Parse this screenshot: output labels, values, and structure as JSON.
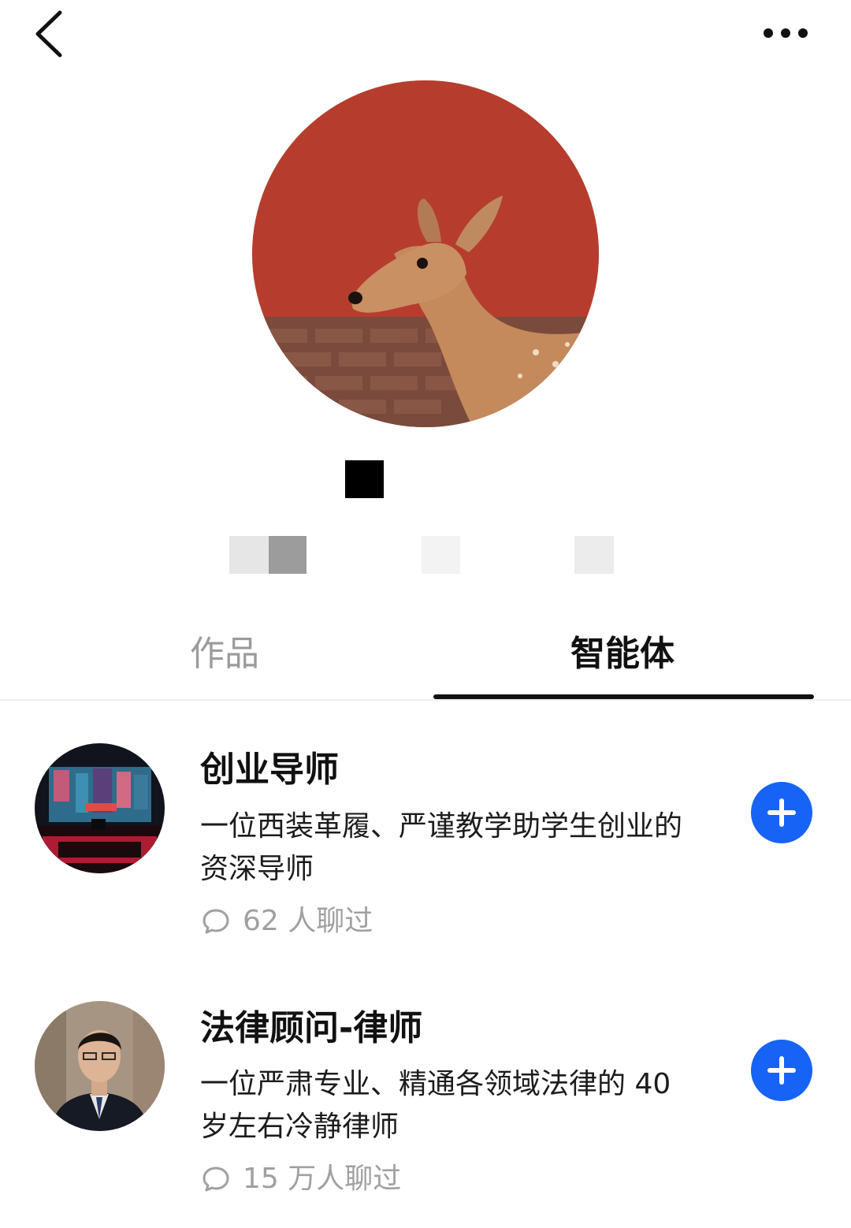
{
  "header": {
    "back_icon": "chevron-left-icon",
    "more_icon": "more-dots-icon"
  },
  "profile": {
    "avatar_desc": "deer-avatar",
    "accent_wall": "#b23a2a"
  },
  "tabs": [
    {
      "label": "作品",
      "active": false
    },
    {
      "label": "智能体",
      "active": true
    }
  ],
  "agents": [
    {
      "name": "创业导师",
      "desc_line1": "一位西装革履、严谨教学助学生创业的",
      "desc_line2": "资深导师",
      "chats": "62 人聊过"
    },
    {
      "name": "法律顾问-律师",
      "desc_line1": "一位严肃专业、精通各领域法律的 40",
      "desc_line2": "岁左右冷静律师",
      "chats": "15 万人聊过"
    }
  ],
  "colors": {
    "accent": "#1763f5",
    "text": "#111111",
    "muted": "#a0a0a0"
  }
}
